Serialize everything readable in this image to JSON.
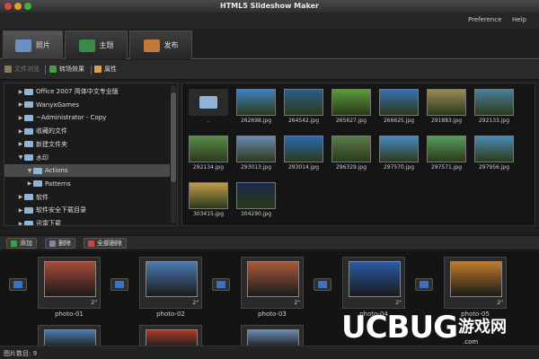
{
  "window": {
    "title": "HTML5 Slideshow Maker"
  },
  "menu": {
    "preference": "Preference",
    "help": "Help"
  },
  "tabs": [
    {
      "label": "照片",
      "active": true
    },
    {
      "label": "主题",
      "active": false
    },
    {
      "label": "发布",
      "active": false
    }
  ],
  "toolbar": {
    "path_label": "文件浏览",
    "transition_label": "转场效果",
    "props_label": "属性"
  },
  "tree": [
    {
      "label": "Office 2007 简体中文专业版",
      "level": 1,
      "expanded": false,
      "selected": false
    },
    {
      "label": "WanyxGames",
      "level": 1,
      "expanded": false,
      "selected": false
    },
    {
      "label": "~Administrator - Copy",
      "level": 1,
      "expanded": false,
      "selected": false
    },
    {
      "label": "收藏的文件",
      "level": 1,
      "expanded": false,
      "selected": false
    },
    {
      "label": "新建文件夹",
      "level": 1,
      "expanded": false,
      "selected": false
    },
    {
      "label": "水印",
      "level": 1,
      "expanded": true,
      "selected": false
    },
    {
      "label": "Actions",
      "level": 2,
      "expanded": true,
      "selected": true
    },
    {
      "label": "Patterns",
      "level": 2,
      "expanded": false,
      "selected": false
    },
    {
      "label": "软件",
      "level": 1,
      "expanded": false,
      "selected": false
    },
    {
      "label": "软件安全下载目录",
      "level": 1,
      "expanded": false,
      "selected": false
    },
    {
      "label": "迅雷下载",
      "level": 1,
      "expanded": false,
      "selected": false
    }
  ],
  "grid": {
    "items": [
      {
        "name": "..",
        "kind": "folder",
        "color": "#8fb3d9"
      },
      {
        "name": "262698.jpg",
        "color": "#3d7fc0"
      },
      {
        "name": "264542.jpg",
        "color": "#2d5c8a"
      },
      {
        "name": "265627.jpg",
        "color": "#5a9a3a"
      },
      {
        "name": "266625.jpg",
        "color": "#3a6fb0"
      },
      {
        "name": "291883.jpg",
        "color": "#9a8a5a"
      },
      {
        "name": "292133.jpg",
        "color": "#4a7f9a"
      },
      {
        "name": "292134.jpg",
        "color": "#5a8a4a"
      },
      {
        "name": "293013.jpg",
        "color": "#6a8ab0"
      },
      {
        "name": "293014.jpg",
        "color": "#2a6ab0"
      },
      {
        "name": "296329.jpg",
        "color": "#5a7a4a"
      },
      {
        "name": "297570.jpg",
        "color": "#4a8ac0"
      },
      {
        "name": "297571.jpg",
        "color": "#5a9a5a"
      },
      {
        "name": "297956.jpg",
        "color": "#4a8ab0"
      },
      {
        "name": "303415.jpg",
        "color": "#c09a4a"
      },
      {
        "name": "304290.jpg",
        "color": "#1a2a4a"
      }
    ]
  },
  "bottom_toolbar": {
    "add_label": "添加",
    "delete_label": "删除",
    "delete_all_label": "全部删除"
  },
  "storyboard": {
    "slides": [
      {
        "name": "photo-01",
        "duration": "2\"",
        "color": "#a84a3a"
      },
      {
        "name": "photo-02",
        "duration": "2\"",
        "color": "#4a7ab0"
      },
      {
        "name": "photo-03",
        "duration": "2\"",
        "color": "#a85a3a"
      },
      {
        "name": "photo-04",
        "duration": "2\"",
        "color": "#2a5aa8"
      },
      {
        "name": "photo-05",
        "duration": "2\"",
        "color": "#c07a2a"
      }
    ],
    "second_row": [
      {
        "color": "#4a7ab0"
      },
      {
        "color": "#a83a2a"
      },
      {
        "color": "#6a8ab0"
      }
    ]
  },
  "status": {
    "text": "图片数目: 9"
  },
  "watermark": {
    "logo": "UCBUG",
    "cn": "游戏网",
    "url": ".com"
  }
}
